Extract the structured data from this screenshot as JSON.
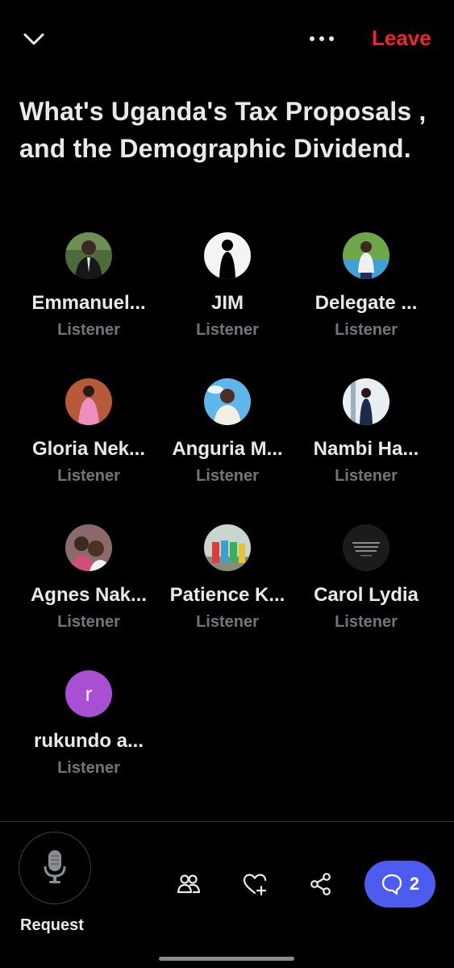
{
  "header": {
    "leave_label": "Leave"
  },
  "space": {
    "title": "What's Uganda's Tax Proposals , and the Demographic Dividend."
  },
  "people": [
    {
      "name": "Emmanuel...",
      "role": "Listener",
      "avatar": "photo-man-suit"
    },
    {
      "name": "JIM",
      "role": "Listener",
      "avatar": "silhouette"
    },
    {
      "name": "Delegate ...",
      "role": "Listener",
      "avatar": "photo-poolside"
    },
    {
      "name": "Gloria Nek...",
      "role": "Listener",
      "avatar": "photo-pink-outfit"
    },
    {
      "name": "Anguria M...",
      "role": "Listener",
      "avatar": "photo-sky-portrait"
    },
    {
      "name": "Nambi Ha...",
      "role": "Listener",
      "avatar": "photo-doorway"
    },
    {
      "name": "Agnes Nak...",
      "role": "Listener",
      "avatar": "photo-selfie"
    },
    {
      "name": "Patience K...",
      "role": "Listener",
      "avatar": "photo-group"
    },
    {
      "name": "Carol Lydia",
      "role": "Listener",
      "avatar": "quote-image"
    },
    {
      "name": "rukundo a...",
      "role": "Listener",
      "avatar_letter": "r",
      "avatar_color": "#a94fd3"
    }
  ],
  "footer": {
    "request_label": "Request",
    "comments_count": "2",
    "icons": [
      "microphone-icon",
      "people-icon",
      "heart-plus-icon",
      "share-icon",
      "comment-icon"
    ]
  },
  "colors": {
    "leave": "#f4212e",
    "accent": "#4c5bf0",
    "muted": "#71767b"
  }
}
